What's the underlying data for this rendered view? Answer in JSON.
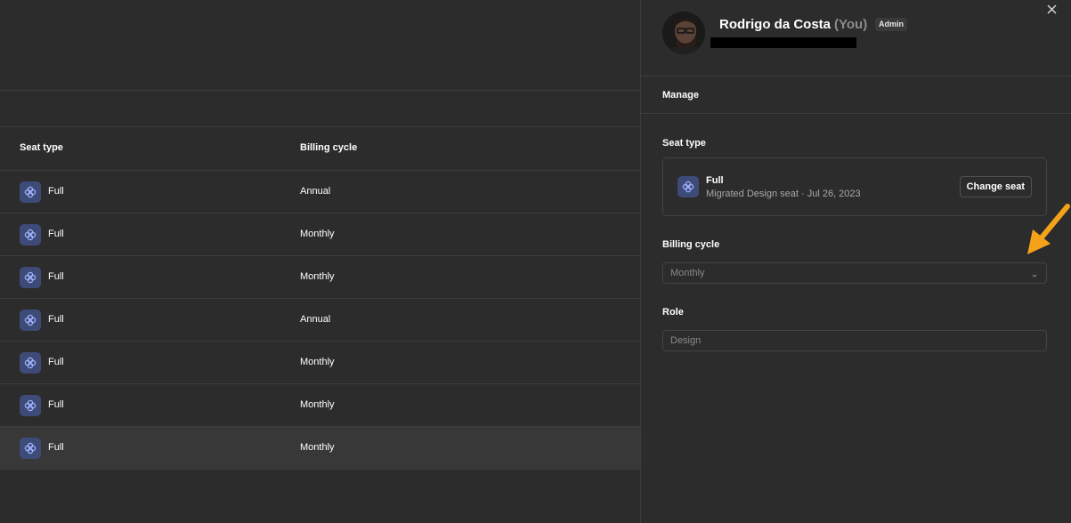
{
  "table": {
    "headers": {
      "seat_type": "Seat type",
      "billing_cycle": "Billing cycle"
    },
    "rows": [
      {
        "seat_type": "Full",
        "billing_cycle": "Annual"
      },
      {
        "seat_type": "Full",
        "billing_cycle": "Monthly"
      },
      {
        "seat_type": "Full",
        "billing_cycle": "Monthly"
      },
      {
        "seat_type": "Full",
        "billing_cycle": "Annual"
      },
      {
        "seat_type": "Full",
        "billing_cycle": "Monthly"
      },
      {
        "seat_type": "Full",
        "billing_cycle": "Monthly"
      },
      {
        "seat_type": "Full",
        "billing_cycle": "Monthly"
      }
    ]
  },
  "panel": {
    "user": {
      "name": "Rodrigo da Costa",
      "you_label": "(You)",
      "badge": "Admin"
    },
    "manage_title": "Manage",
    "seat_type": {
      "title": "Seat type",
      "card_title": "Full",
      "card_subtitle": "Migrated Design seat · Jul 26, 2023",
      "change_button": "Change seat"
    },
    "billing_cycle": {
      "title": "Billing cycle",
      "value": "Monthly"
    },
    "role": {
      "title": "Role",
      "value": "Design"
    }
  },
  "icons": {
    "seat": "design-seat-icon",
    "close": "close-icon",
    "chevron": "chevron-down-icon",
    "annotation": "arrow-annotation"
  },
  "colors": {
    "background": "#2c2c2c",
    "border": "#3d3d3d",
    "seat_icon_bg": "#3e4b78",
    "seat_icon_fg": "#9fb4ff",
    "annotation_arrow": "#f5a21b",
    "selected_row": "#383838"
  }
}
